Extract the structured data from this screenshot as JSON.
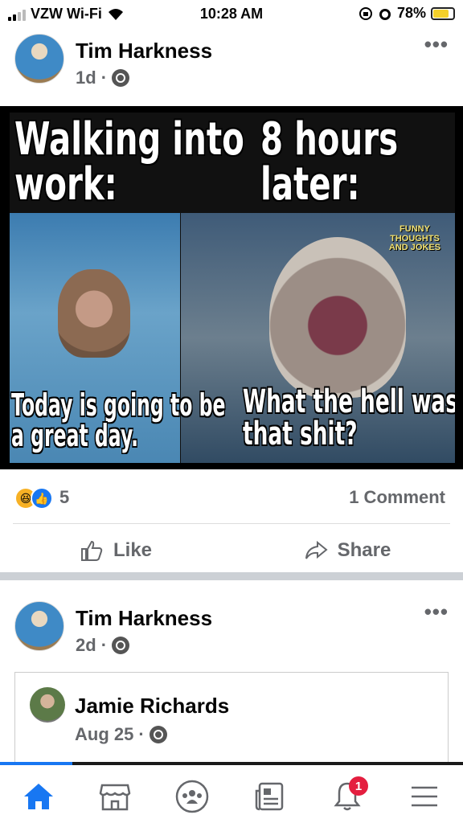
{
  "status_bar": {
    "carrier": "VZW Wi-Fi",
    "time": "10:28 AM",
    "battery": "78%",
    "battery_level": 0.78
  },
  "post1": {
    "author": "Tim Harkness",
    "time": "1d",
    "separator": "·",
    "more": "•••",
    "meme": {
      "top_left": "Walking into work:",
      "top_right": "8 hours later:",
      "watermark": "FUNNY THOUGHTS AND JOKES",
      "bottom_left": "Today is going to be a great day.",
      "bottom_right": "What the hell was that shit?"
    },
    "reaction_count": "5",
    "comment_count": "1 Comment",
    "actions": {
      "like": "Like",
      "share": "Share"
    }
  },
  "post2": {
    "author": "Tim Harkness",
    "time": "2d",
    "separator": "·",
    "more": "•••",
    "shared": {
      "author": "Jamie Richards",
      "date": "Aug 25",
      "separator": "·"
    }
  },
  "tabbar": {
    "items": [
      "home-icon",
      "marketplace-icon",
      "groups-icon",
      "news-icon",
      "notifications-icon",
      "menu-icon"
    ],
    "notification_badge": "1",
    "accent_color": "#1877f2"
  }
}
